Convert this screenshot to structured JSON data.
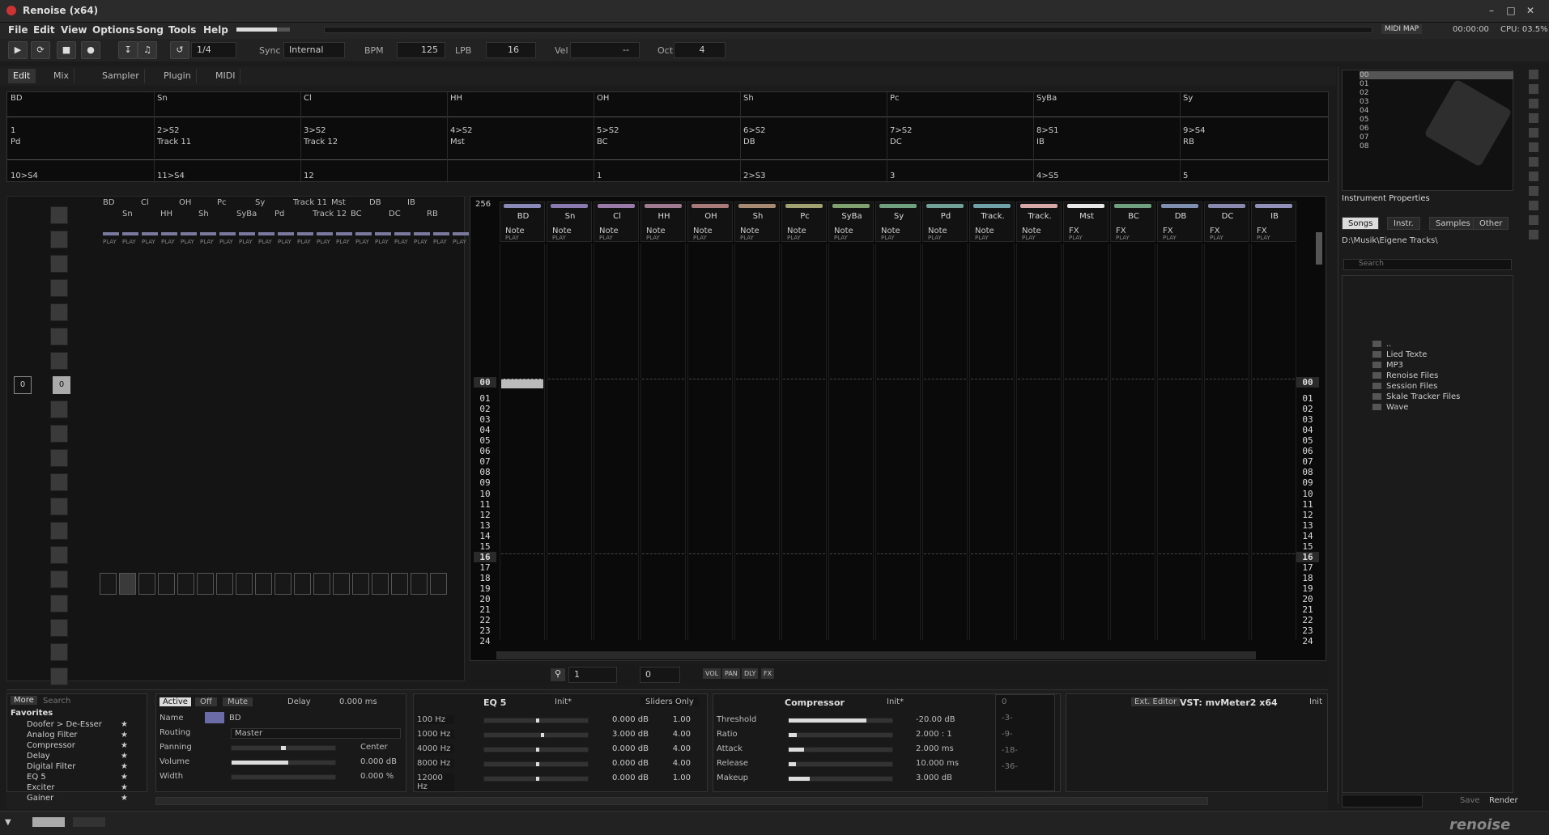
{
  "app": {
    "title": "Renoise (x64)"
  },
  "menu": [
    "File",
    "Edit",
    "View",
    "Options",
    "Song",
    "Tools",
    "Help"
  ],
  "top_right": {
    "midimap": "MIDI MAP",
    "time": "00:00:00",
    "cpu": "CPU: 03.5%"
  },
  "transport": {
    "step": "1/4",
    "sync_label": "Sync",
    "sync_value": "Internal",
    "bpm_label": "BPM",
    "bpm": "125",
    "lpb_label": "LPB",
    "lpb": "16",
    "vel_label": "Vel",
    "vel": "--",
    "oct_label": "Oct",
    "oct": "4"
  },
  "modes": [
    "Edit",
    "Mix",
    "Sampler",
    "Plugin",
    "MIDI"
  ],
  "seq_row1": {
    "names": [
      "BD",
      "Sn",
      "Cl",
      "HH",
      "OH",
      "Sh",
      "Pc",
      "SyBa",
      "Sy"
    ],
    "routes": [
      "1",
      "2>S2",
      "3>S2",
      "4>S2",
      "5>S2",
      "6>S2",
      "7>S2",
      "8>S1",
      "9>S4"
    ]
  },
  "seq_row2": {
    "names": [
      "Pd",
      "Track 11",
      "Track 12",
      "Mst",
      "BC",
      "DB",
      "DC",
      "IB",
      "RB"
    ],
    "routes": [
      "10>S4",
      "11>S4",
      "12",
      "",
      "1",
      "2>S3",
      "3",
      "4>S5",
      "5"
    ]
  },
  "matrix": {
    "top": [
      "BD",
      "Cl",
      "OH",
      "Pc",
      "Sy",
      "Track 11",
      "Mst",
      "DB",
      "IB"
    ],
    "bottom": [
      "Sn",
      "HH",
      "Sh",
      "SyBa",
      "Pd",
      "Track 12",
      "BC",
      "DC",
      "RB"
    ],
    "seq_value": "0",
    "seq_index": "0"
  },
  "pattern": {
    "lines": "256",
    "tracks": [
      {
        "name": "BD",
        "type": "Note",
        "color": "#8a8ab8"
      },
      {
        "name": "Sn",
        "type": "Note",
        "color": "#8a7ab0"
      },
      {
        "name": "Cl",
        "type": "Note",
        "color": "#9a7aa8"
      },
      {
        "name": "HH",
        "type": "Note",
        "color": "#a07a90"
      },
      {
        "name": "OH",
        "type": "Note",
        "color": "#a87a7a"
      },
      {
        "name": "Sh",
        "type": "Note",
        "color": "#a88a72"
      },
      {
        "name": "Pc",
        "type": "Note",
        "color": "#a0a070"
      },
      {
        "name": "SyBa",
        "type": "Note",
        "color": "#80a070"
      },
      {
        "name": "Sy",
        "type": "Note",
        "color": "#70a080"
      },
      {
        "name": "Pd",
        "type": "Note",
        "color": "#70a098"
      },
      {
        "name": "Track.",
        "type": "Note",
        "color": "#70a0a8"
      },
      {
        "name": "Track.",
        "type": "Note",
        "color": "#d8a8a8"
      },
      {
        "name": "Mst",
        "type": "FX",
        "color": "#e8e8e8"
      },
      {
        "name": "BC",
        "type": "FX",
        "color": "#70a080"
      },
      {
        "name": "DB",
        "type": "FX",
        "color": "#8090b0"
      },
      {
        "name": "DC",
        "type": "FX",
        "color": "#8a8ab0"
      },
      {
        "name": "IB",
        "type": "FX",
        "color": "#9090b8"
      }
    ],
    "play": "PLAY",
    "rows": [
      "00",
      "01",
      "02",
      "03",
      "04",
      "05",
      "06",
      "07",
      "08",
      "09",
      "10",
      "11",
      "12",
      "13",
      "14",
      "15",
      "16",
      "17",
      "18",
      "19",
      "20",
      "21",
      "22",
      "23",
      "24"
    ],
    "toolbar": {
      "step": "1",
      "edit": "0",
      "vol": "VOL",
      "pan": "PAN",
      "dly": "DLY",
      "fx": "FX"
    }
  },
  "right": {
    "seq_list": [
      "00",
      "01",
      "02",
      "03",
      "04",
      "05",
      "06",
      "07",
      "08"
    ],
    "header": "Instrument Properties",
    "tabs": [
      "Songs",
      "Instr.",
      "Samples",
      "Other"
    ],
    "path": "D:\\Musik\\Eigene Tracks\\",
    "search": "Search",
    "files": [
      "..",
      "Lied Texte",
      "MP3",
      "Renoise Files",
      "Session Files",
      "Skale Tracker Files",
      "Wave"
    ],
    "save": "Save",
    "render": "Render"
  },
  "dsp_list": {
    "more": "More",
    "search": "Search",
    "favorites": "Favorites",
    "items": [
      "Doofer > De-Esser",
      "Analog Filter",
      "Compressor",
      "Delay",
      "Digital Filter",
      "EQ 5",
      "Exciter",
      "Gainer"
    ]
  },
  "mixer": {
    "active": "Active",
    "off": "Off",
    "mute": "Mute",
    "delay_label": "Delay",
    "delay": "0.000 ms",
    "name_label": "Name",
    "name": "BD",
    "routing_label": "Routing",
    "routing": "Master",
    "panning_label": "Panning",
    "panning": "Center",
    "volume_label": "Volume",
    "volume": "0.000 dB",
    "width_label": "Width",
    "width": "0.000 %",
    "volume_level": 0.55,
    "panning_level": 0.5
  },
  "eq": {
    "title": "EQ 5",
    "preset": "Init*",
    "mode": "Sliders Only",
    "bands": [
      {
        "freq": "100 Hz",
        "gain": "0.000 dB",
        "q": "1.00",
        "level": 0.5
      },
      {
        "freq": "1000 Hz",
        "gain": "3.000 dB",
        "q": "4.00",
        "level": 0.55
      },
      {
        "freq": "4000 Hz",
        "gain": "0.000 dB",
        "q": "4.00",
        "level": 0.5
      },
      {
        "freq": "8000 Hz",
        "gain": "0.000 dB",
        "q": "4.00",
        "level": 0.5
      },
      {
        "freq": "12000 Hz",
        "gain": "0.000 dB",
        "q": "1.00",
        "level": 0.5
      }
    ]
  },
  "comp": {
    "title": "Compressor",
    "preset": "Init*",
    "params": [
      {
        "name": "Threshold",
        "value": "-20.00 dB",
        "level": 0.75
      },
      {
        "name": "Ratio",
        "value": "2.000 : 1",
        "level": 0.08
      },
      {
        "name": "Attack",
        "value": "2.000 ms",
        "level": 0.15
      },
      {
        "name": "Release",
        "value": "10.000 ms",
        "level": 0.07
      },
      {
        "name": "Makeup",
        "value": "3.000 dB",
        "level": 0.2
      }
    ],
    "meter": [
      "0",
      "-3-",
      "-9-",
      "-18-",
      "-36-"
    ]
  },
  "vst": {
    "ext": "Ext. Editor",
    "title": "VST: mvMeter2 x64",
    "preset": "Init"
  },
  "statusbar": {
    "logo": "renoise"
  }
}
